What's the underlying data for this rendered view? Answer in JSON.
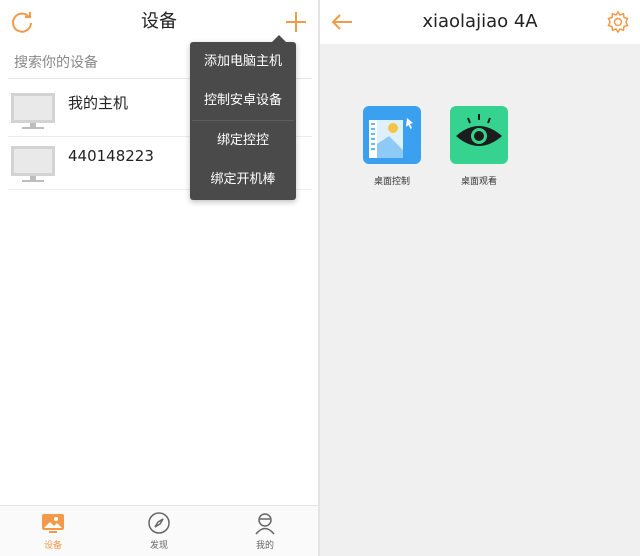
{
  "colors": {
    "accent": "#f39a4a",
    "menu_bg": "#4a4a4a",
    "icon_blue": "#3ba0f0",
    "icon_green": "#35d38f"
  },
  "left_screen": {
    "header": {
      "title": "设备",
      "refresh_icon": "refresh-icon",
      "add_icon": "plus-icon"
    },
    "search": {
      "placeholder": "搜索你的设备"
    },
    "devices": [
      {
        "name": "我的主机",
        "icon": "monitor-icon"
      },
      {
        "name": "440148223",
        "icon": "monitor-icon"
      }
    ],
    "popup_menu": {
      "items": [
        {
          "label": "添加电脑主机"
        },
        {
          "label": "控制安卓设备"
        },
        {
          "label": "绑定控控"
        },
        {
          "label": "绑定开机棒"
        }
      ]
    },
    "tabbar": {
      "tabs": [
        {
          "label": "设备",
          "icon": "devices-icon",
          "active": true
        },
        {
          "label": "发现",
          "icon": "compass-icon",
          "active": false
        },
        {
          "label": "我的",
          "icon": "profile-icon",
          "active": false
        }
      ]
    }
  },
  "right_screen": {
    "header": {
      "title": "xiaolajiao 4A",
      "back_icon": "back-arrow-icon",
      "settings_icon": "gear-icon"
    },
    "apps": [
      {
        "label": "桌面控制",
        "icon": "desktop-control-icon"
      },
      {
        "label": "桌面观看",
        "icon": "desktop-watch-eye-icon"
      }
    ]
  }
}
